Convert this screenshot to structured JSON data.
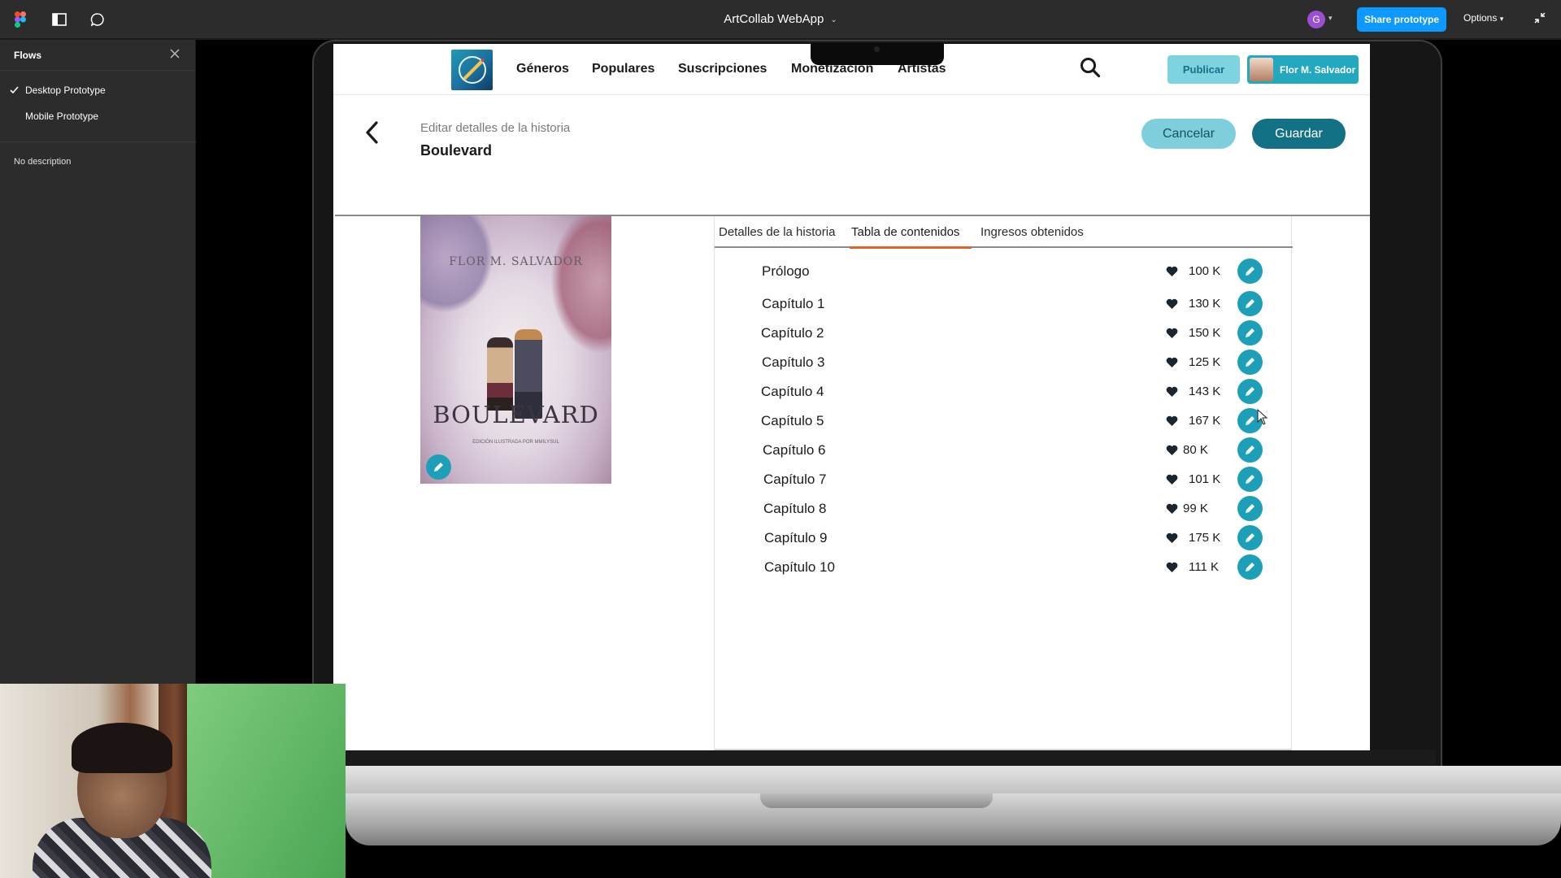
{
  "figma": {
    "file_title": "ArtCollab WebApp",
    "share_label": "Share prototype",
    "options_label": "Options",
    "user_initial": "G"
  },
  "flows": {
    "title": "Flows",
    "items": [
      {
        "label": "Desktop Prototype",
        "selected": true
      },
      {
        "label": "Mobile Prototype",
        "selected": false
      }
    ],
    "description": "No description"
  },
  "app": {
    "nav": {
      "links": [
        "Géneros",
        "Populares",
        "Suscripciones",
        "Monetización",
        "Artistas"
      ],
      "publish_label": "Publicar",
      "user_name": "Flor M. Salvador"
    },
    "header": {
      "subtitle": "Editar detalles de la historia",
      "title": "Boulevard",
      "cancel_label": "Cancelar",
      "save_label": "Guardar"
    },
    "cover": {
      "author": "FLOR M. SALVADOR",
      "title": "BOULEVARD",
      "tagline": "EDICIÓN ILUSTRADA POR MMILYSUL"
    },
    "tabs": [
      {
        "label": "Detalles de la historia",
        "active": false
      },
      {
        "label": "Tabla de contenidos",
        "active": true
      },
      {
        "label": "Ingresos obtenidos",
        "active": false
      }
    ],
    "chapters": [
      {
        "name": "Prólogo",
        "likes": "100 K"
      },
      {
        "name": "Capítulo 1",
        "likes": "130 K"
      },
      {
        "name": "Capítulo 2",
        "likes": "150 K"
      },
      {
        "name": "Capítulo 3",
        "likes": "125 K"
      },
      {
        "name": "Capítulo 4",
        "likes": "143 K"
      },
      {
        "name": "Capítulo 5",
        "likes": "167 K"
      },
      {
        "name": "Capítulo 6",
        "likes": "80 K"
      },
      {
        "name": "Capítulo 7",
        "likes": "101 K"
      },
      {
        "name": "Capítulo 8",
        "likes": "99 K"
      },
      {
        "name": "Capítulo 9",
        "likes": "175 K"
      },
      {
        "name": "Capítulo 10",
        "likes": "111 K"
      }
    ]
  },
  "colors": {
    "accent": "#1e9fb8",
    "save": "#137186",
    "publish": "#7dd3e0",
    "tab_underline": "#e0632a",
    "figma_share": "#0d99ff"
  }
}
